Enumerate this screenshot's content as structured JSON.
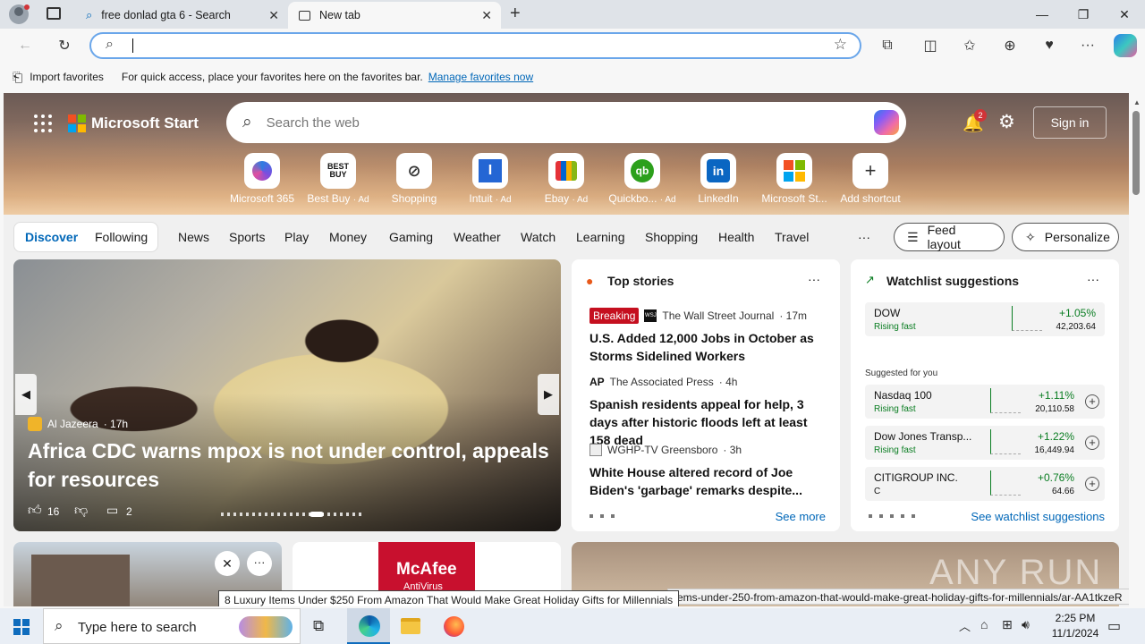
{
  "browser": {
    "tabs": [
      {
        "label": "free donlad gta 6 - Search"
      },
      {
        "label": "New tab"
      }
    ],
    "address": {
      "value": "",
      "placeholder": ""
    },
    "favorites_bar": {
      "import_label": "Import favorites",
      "hint": "For quick access, place your favorites here on the favorites bar.",
      "manage_link": "Manage favorites now"
    }
  },
  "header": {
    "brand": "Microsoft Start",
    "search_placeholder": "Search the web",
    "notification_count": "2",
    "signin_label": "Sign in"
  },
  "shortcuts": [
    {
      "label": "Microsoft 365",
      "ad": ""
    },
    {
      "label": "Best Buy",
      "ad": "· Ad"
    },
    {
      "label": "Shopping",
      "ad": ""
    },
    {
      "label": "Intuit",
      "ad": "· Ad"
    },
    {
      "label": "Ebay",
      "ad": "· Ad"
    },
    {
      "label": "Quickbo...",
      "ad": "· Ad"
    },
    {
      "label": "LinkedIn",
      "ad": ""
    },
    {
      "label": "Microsoft St...",
      "ad": ""
    },
    {
      "label": "Add shortcut",
      "ad": ""
    }
  ],
  "nav": {
    "discover": "Discover",
    "following": "Following",
    "items": [
      "News",
      "Sports",
      "Play",
      "Money",
      "Gaming",
      "Weather",
      "Watch",
      "Learning",
      "Shopping",
      "Health",
      "Travel"
    ],
    "more": "···",
    "feed_layout": "Feed layout",
    "personalize": "Personalize"
  },
  "hero_story": {
    "source": "Al Jazeera",
    "age": "· 17h",
    "headline": "Africa CDC warns mpox is not under control, appeals for resources",
    "likes": "16",
    "comments": "2"
  },
  "top_stories": {
    "title": "Top stories",
    "items": [
      {
        "badge": "Breaking",
        "source": "The Wall Street Journal",
        "age": "· 17m",
        "headline": "U.S. Added 12,000 Jobs in October as Storms Sidelined Workers"
      },
      {
        "badge": "",
        "source": "The Associated Press",
        "age": "· 4h",
        "headline": "Spanish residents appeal for help, 3 days after historic floods left at least 158 dead"
      },
      {
        "badge": "",
        "source": "WGHP-TV Greensboro",
        "age": "· 3h",
        "headline": "White House altered record of Joe Biden's 'garbage' remarks despite..."
      }
    ],
    "see_more": "See more"
  },
  "watchlist": {
    "title": "Watchlist suggestions",
    "main": {
      "name": "DOW",
      "status": "Rising fast",
      "pct": "+1.05%",
      "value": "42,203.64"
    },
    "suggested_label": "Suggested for you",
    "items": [
      {
        "name": "Nasdaq 100",
        "status": "Rising fast",
        "pct": "+1.11%",
        "value": "20,110.58"
      },
      {
        "name": "Dow Jones Transp...",
        "status": "Rising fast",
        "pct": "+1.22%",
        "value": "16,449.94"
      },
      {
        "name": "CITIGROUP INC.",
        "status": "C",
        "pct": "+0.76%",
        "value": "64.66"
      }
    ],
    "see_all": "See watchlist suggestions"
  },
  "ad_brand": "McAfee",
  "ad_sub": "AntiVirus",
  "tooltip": "8 Luxury Items Under $250 From Amazon That Would Make Great Holiday Gifts for Millennials",
  "status_url": "items-under-250-from-amazon-that-would-make-great-holiday-gifts-for-millennials/ar-AA1tkzeR",
  "watermark": "ANY RUN",
  "taskbar": {
    "search_placeholder": "Type here to search",
    "time": "2:25 PM",
    "date": "11/1/2024"
  },
  "colors": {
    "accent": "#0067b8",
    "positive": "#0a7d22",
    "breaking": "#c50f1f"
  }
}
